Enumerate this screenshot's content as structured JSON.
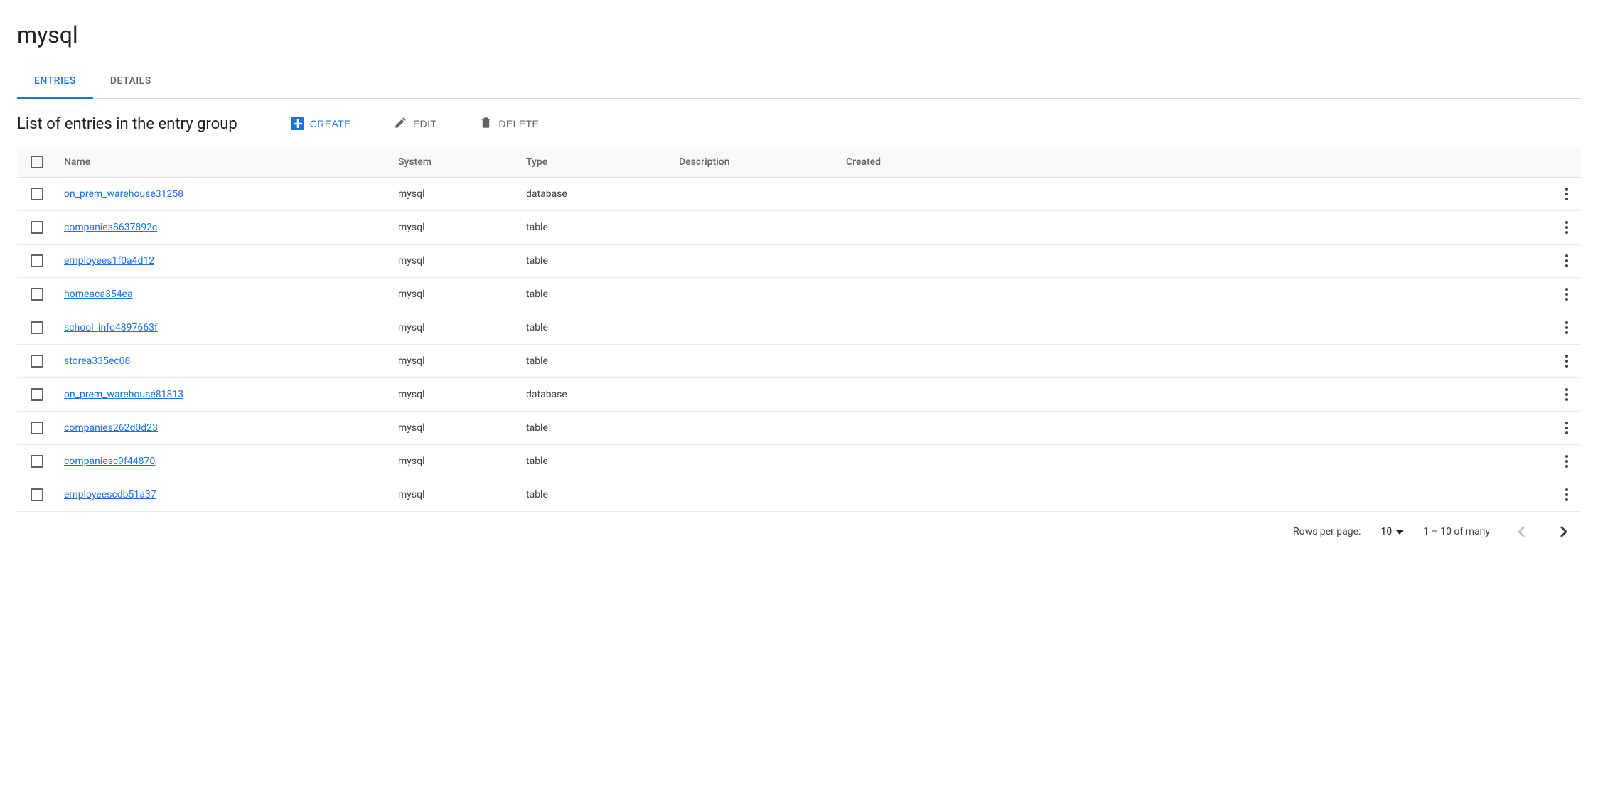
{
  "page": {
    "title": "mysql",
    "subtitle": "List of entries in the entry group"
  },
  "tabs": [
    {
      "label": "ENTRIES",
      "active": true
    },
    {
      "label": "DETAILS",
      "active": false
    }
  ],
  "actions": {
    "create": "CREATE",
    "edit": "EDIT",
    "delete": "DELETE"
  },
  "table": {
    "headers": {
      "name": "Name",
      "system": "System",
      "type": "Type",
      "description": "Description",
      "created": "Created"
    },
    "rows": [
      {
        "name": "on_prem_warehouse31258",
        "system": "mysql",
        "type": "database",
        "description": "",
        "created": ""
      },
      {
        "name": "companies8637892c",
        "system": "mysql",
        "type": "table",
        "description": "",
        "created": ""
      },
      {
        "name": "employees1f0a4d12",
        "system": "mysql",
        "type": "table",
        "description": "",
        "created": ""
      },
      {
        "name": "homeaca354ea",
        "system": "mysql",
        "type": "table",
        "description": "",
        "created": ""
      },
      {
        "name": "school_info4897663f",
        "system": "mysql",
        "type": "table",
        "description": "",
        "created": ""
      },
      {
        "name": "storea335ec08",
        "system": "mysql",
        "type": "table",
        "description": "",
        "created": ""
      },
      {
        "name": "on_prem_warehouse81813",
        "system": "mysql",
        "type": "database",
        "description": "",
        "created": ""
      },
      {
        "name": "companies262d0d23",
        "system": "mysql",
        "type": "table",
        "description": "",
        "created": ""
      },
      {
        "name": "companiesc9f44870",
        "system": "mysql",
        "type": "table",
        "description": "",
        "created": ""
      },
      {
        "name": "employeescdb51a37",
        "system": "mysql",
        "type": "table",
        "description": "",
        "created": ""
      }
    ]
  },
  "pagination": {
    "rows_per_page_label": "Rows per page:",
    "rows_per_page_value": "10",
    "range_text": "1 – 10 of many"
  }
}
